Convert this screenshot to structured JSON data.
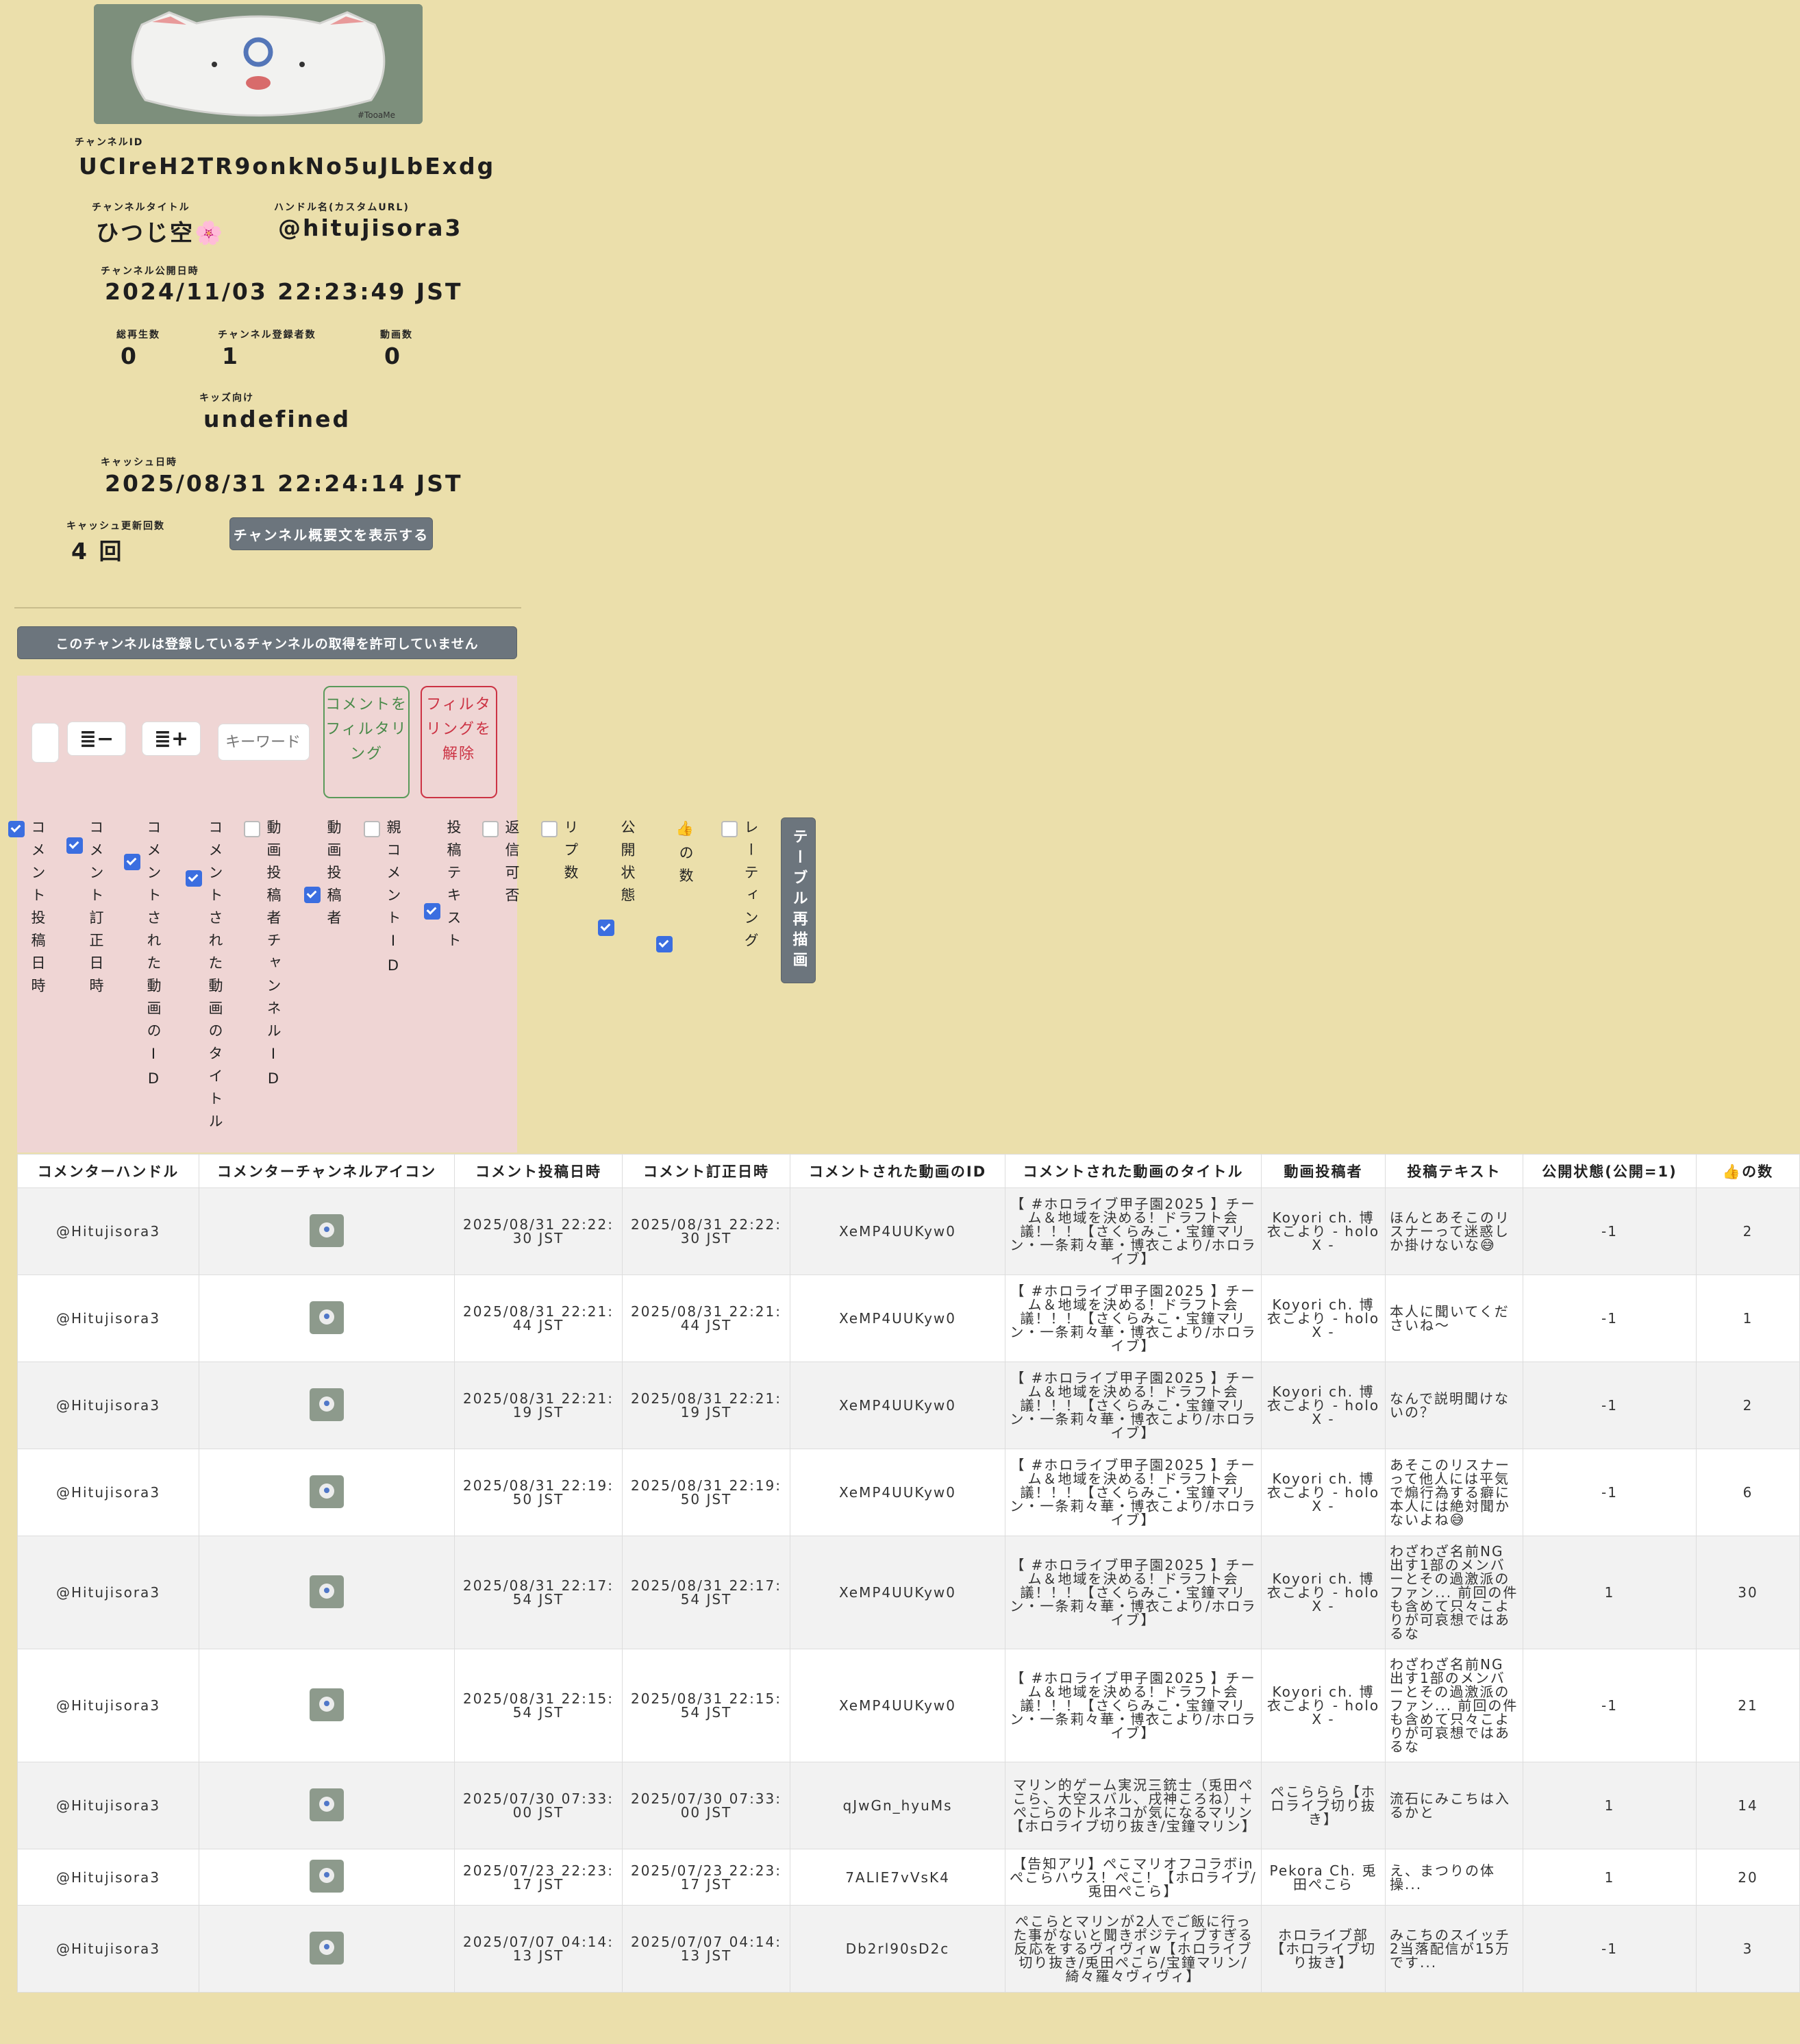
{
  "channel": {
    "id_label": "チャンネルID",
    "id": "UCIreH2TR9onkNo5uJLbExdg",
    "title_label": "チャンネルタイトル",
    "title": "ひつじ空🌸",
    "handle_label": "ハンドル名(カスタムURL)",
    "handle": "@hitujisora3",
    "published_label": "チャンネル公開日時",
    "published": "2024/11/03 22:23:49 JST",
    "views_label": "総再生数",
    "views": "0",
    "subs_label": "チャンネル登録者数",
    "subs": "1",
    "videos_label": "動画数",
    "videos": "0",
    "kids_label": "キッズ向け",
    "kids": "undefined",
    "cache_date_label": "キャッシュ日時",
    "cache_date": "2025/08/31 22:24:14 JST",
    "cache_count_label": "キャッシュ更新回数",
    "cache_count": "4 回",
    "show_description_button": "チャンネル概要文を表示する",
    "avatar_watermark": "#TooaMe"
  },
  "subscriptions_notice": "このチャンネルは登録しているチャンネルの取得を許可していません",
  "filter": {
    "minus_label": "≣−",
    "plus_label": "≣+",
    "keyword_placeholder": "キーワード",
    "filter_button": "コメントをフィルタリング",
    "clear_button": "フィルタリングを解除",
    "redraw_button": "テーブル再描画"
  },
  "column_toggles": [
    {
      "label": "コメント投稿日時",
      "checked": true
    },
    {
      "label": "コメント訂正日時",
      "checked": true
    },
    {
      "label": "コメントされた動画のID",
      "checked": true
    },
    {
      "label": "コメントされた動画のタイトル",
      "checked": true
    },
    {
      "label": "動画投稿者チャンネルID",
      "checked": false
    },
    {
      "label": "動画投稿者",
      "checked": true
    },
    {
      "label": "親コメントID",
      "checked": false
    },
    {
      "label": "投稿テキスト",
      "checked": true
    },
    {
      "label": "返信可否",
      "checked": false
    },
    {
      "label": "リプ数",
      "checked": false
    },
    {
      "label": "公開状態",
      "checked": true
    },
    {
      "label": "👍の数",
      "checked": true
    },
    {
      "label": "レーティング",
      "checked": false
    }
  ],
  "table": {
    "headers": [
      "コメンターハンドル",
      "コメンターチャンネルアイコン",
      "コメント投稿日時",
      "コメント訂正日時",
      "コメントされた動画のID",
      "コメントされた動画のタイトル",
      "動画投稿者",
      "投稿テキスト",
      "公開状態(公開=1)",
      "👍の数"
    ],
    "rows": [
      {
        "handle": "@Hitujisora3",
        "posted": "2025/08/31 22:22:30 JST",
        "edited": "2025/08/31 22:22:30 JST",
        "video_id": "XeMP4UUKyw0",
        "video_title": "【 #ホロライブ甲子園2025 】チーム＆地域を決める！ドラフト会議！！！【さくらみこ・宝鐘マリン・一条莉々華・博衣こより/ホロライブ】",
        "uploader": "Koyori ch. 博衣こより - holoX -",
        "text": "ほんとあそこのリスナーって迷惑しか掛けないな😅",
        "public": "-1",
        "likes": "2"
      },
      {
        "handle": "@Hitujisora3",
        "posted": "2025/08/31 22:21:44 JST",
        "edited": "2025/08/31 22:21:44 JST",
        "video_id": "XeMP4UUKyw0",
        "video_title": "【 #ホロライブ甲子園2025 】チーム＆地域を決める！ドラフト会議！！！【さくらみこ・宝鐘マリン・一条莉々華・博衣こより/ホロライブ】",
        "uploader": "Koyori ch. 博衣こより - holoX -",
        "text": "本人に聞いてくださいね〜",
        "public": "-1",
        "likes": "1"
      },
      {
        "handle": "@Hitujisora3",
        "posted": "2025/08/31 22:21:19 JST",
        "edited": "2025/08/31 22:21:19 JST",
        "video_id": "XeMP4UUKyw0",
        "video_title": "【 #ホロライブ甲子園2025 】チーム＆地域を決める！ドラフト会議！！！【さくらみこ・宝鐘マリン・一条莉々華・博衣こより/ホロライブ】",
        "uploader": "Koyori ch. 博衣こより - holoX -",
        "text": "なんで説明聞けないの？",
        "public": "-1",
        "likes": "2"
      },
      {
        "handle": "@Hitujisora3",
        "posted": "2025/08/31 22:19:50 JST",
        "edited": "2025/08/31 22:19:50 JST",
        "video_id": "XeMP4UUKyw0",
        "video_title": "【 #ホロライブ甲子園2025 】チーム＆地域を決める！ドラフト会議！！！【さくらみこ・宝鐘マリン・一条莉々華・博衣こより/ホロライブ】",
        "uploader": "Koyori ch. 博衣こより - holoX -",
        "text": "あそこのリスナーって他人には平気で煽行為する癖に本人には絶対聞かないよね😅",
        "public": "-1",
        "likes": "6"
      },
      {
        "handle": "@Hitujisora3",
        "posted": "2025/08/31 22:17:54 JST",
        "edited": "2025/08/31 22:17:54 JST",
        "video_id": "XeMP4UUKyw0",
        "video_title": "【 #ホロライブ甲子園2025 】チーム＆地域を決める！ドラフト会議！！！【さくらみこ・宝鐘マリン・一条莉々華・博衣こより/ホロライブ】",
        "uploader": "Koyori ch. 博衣こより - holoX -",
        "text": "わざわざ名前NG出す1部のメンバーとその過激派のファン... 前回の件も含めて只々こよりが可哀想ではあるな",
        "public": "1",
        "likes": "30"
      },
      {
        "handle": "@Hitujisora3",
        "posted": "2025/08/31 22:15:54 JST",
        "edited": "2025/08/31 22:15:54 JST",
        "video_id": "XeMP4UUKyw0",
        "video_title": "【 #ホロライブ甲子園2025 】チーム＆地域を決める！ドラフト会議！！！【さくらみこ・宝鐘マリン・一条莉々華・博衣こより/ホロライブ】",
        "uploader": "Koyori ch. 博衣こより - holoX -",
        "text": "わざわざ名前NG出す1部のメンバーとその過激派のファン... 前回の件も含めて只々こよりが可哀想ではあるな",
        "public": "-1",
        "likes": "21"
      },
      {
        "handle": "@Hitujisora3",
        "posted": "2025/07/30 07:33:00 JST",
        "edited": "2025/07/30 07:33:00 JST",
        "video_id": "qJwGn_hyuMs",
        "video_title": "マリン的ゲーム実況三銃士（兎田ぺこら、大空スバル、戌神ころね）＋ぺこらのトルネコが気になるマリン【ホロライブ切り抜き/宝鐘マリン】",
        "uploader": "ぺこららら【ホロライブ切り抜き】",
        "text": "流石にみこちは入るかと",
        "public": "1",
        "likes": "14"
      },
      {
        "handle": "@Hitujisora3",
        "posted": "2025/07/23 22:23:17 JST",
        "edited": "2025/07/23 22:23:17 JST",
        "video_id": "7ALIE7vVsK4",
        "video_title": "【告知アリ】ぺこマリオフコラボin ぺこらハウス！ぺこ！【ホロライブ/兎田ぺこら】",
        "uploader": "Pekora Ch. 兎田ぺこら",
        "text": "え、まつりの体操...",
        "public": "1",
        "likes": "20"
      },
      {
        "handle": "@Hitujisora3",
        "posted": "2025/07/07 04:14:13 JST",
        "edited": "2025/07/07 04:14:13 JST",
        "video_id": "Db2rl90sD2c",
        "video_title": "ぺこらとマリンが2人でご飯に行った事がないと聞きポジティブすぎる反応をするヴィヴィw【ホロライブ切り抜き/兎田ぺこら/宝鐘マリン/綺々羅々ヴィヴィ】",
        "uploader": "ホロライブ部【ホロライブ切り抜き】",
        "text": "みこちのスイッチ2当落配信が15万です...",
        "public": "-1",
        "likes": "3"
      }
    ]
  }
}
